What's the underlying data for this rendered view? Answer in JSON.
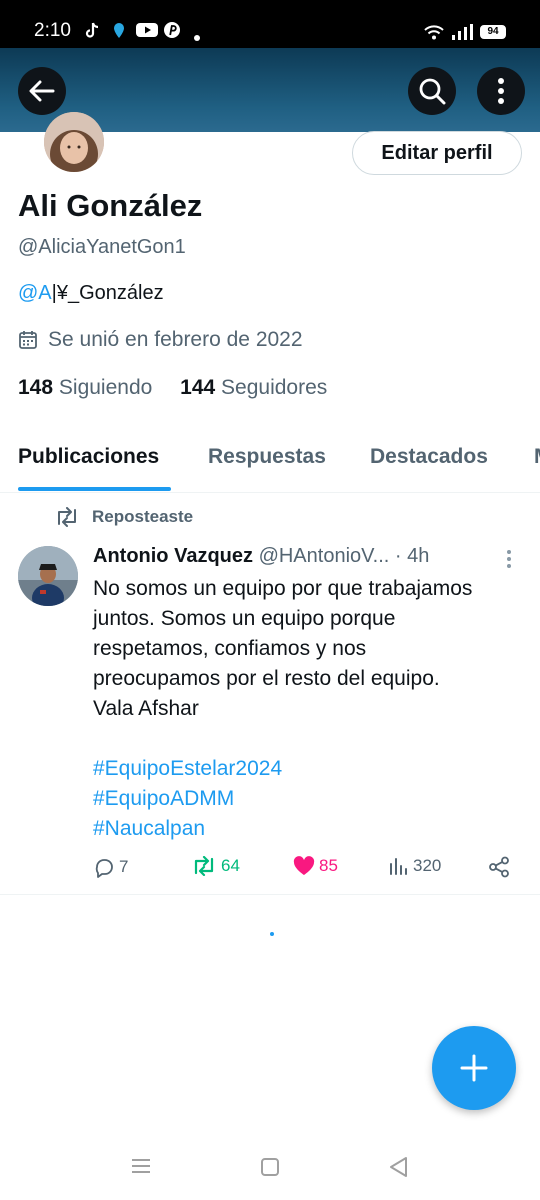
{
  "status_bar": {
    "time": "2:10",
    "battery": "94"
  },
  "profile": {
    "edit_label": "Editar perfil",
    "name": "Ali González",
    "handle": "@AliciaYanetGon1",
    "bio_mention": "@A",
    "bio_rest": "|¥_González",
    "joined": "Se unió en febrero de 2022",
    "following_count": "148",
    "following_label": "Siguiendo",
    "followers_count": "144",
    "followers_label": "Seguidores"
  },
  "tabs": [
    "Publicaciones",
    "Respuestas",
    "Destacados",
    "M"
  ],
  "tweet": {
    "repost_label": "Reposteaste",
    "author": "Antonio Vazquez",
    "author_handle": "@HAntonioV...",
    "time": "· 4h",
    "lines": [
      "No somos un equipo por que trabajamos",
      "juntos. Somos un equipo porque",
      "respetamos, confiamos y nos",
      "preocupamos por el resto del equipo.",
      "Vala Afshar"
    ],
    "hashtags": [
      "#EquipoEstelar2024",
      "#EquipoADMM",
      "#Naucalpan"
    ],
    "replies": "7",
    "reposts": "64",
    "likes": "85",
    "views": "320"
  },
  "colors": {
    "accent": "#1d9bf0",
    "repost_green": "#00ba7c",
    "like_pink": "#f91880",
    "header": "#1f5f82"
  }
}
